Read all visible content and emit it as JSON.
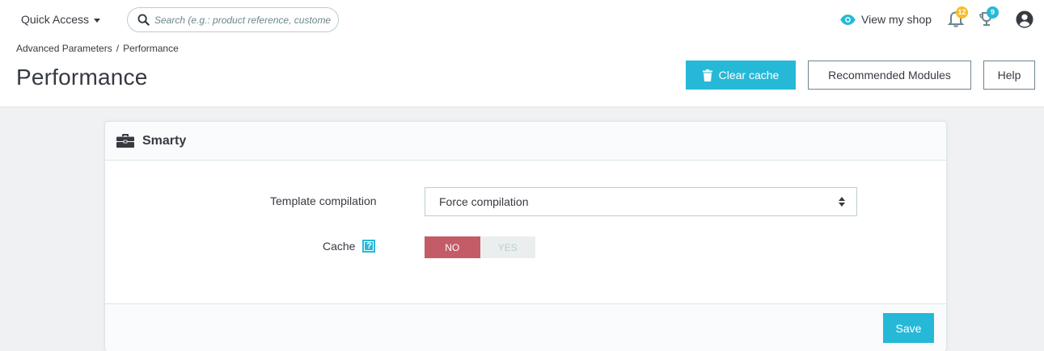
{
  "header": {
    "quick_access_label": "Quick Access",
    "search": {
      "placeholder": "Search (e.g.: product reference, custome",
      "value": ""
    },
    "view_shop_label": "View my shop",
    "notifications": [
      {
        "name": "orders",
        "icon": "bell-icon",
        "count": "12",
        "badge_color": "#fbbb22"
      },
      {
        "name": "customers",
        "icon": "trophy-icon",
        "count": "9",
        "badge_color": "#25b9d7"
      }
    ],
    "avatar_icon": "user-circle-icon"
  },
  "breadcrumb": [
    "Advanced Parameters",
    "/",
    "Performance"
  ],
  "page_title": "Performance",
  "toolbar": {
    "clear_cache_label": "Clear cache",
    "recommended_modules_label": "Recommended Modules",
    "help_label": "Help"
  },
  "panel": {
    "title": "Smarty",
    "icon": "briefcase-icon",
    "template_compilation": {
      "label": "Template compilation",
      "selected": "Force compilation"
    },
    "cache": {
      "label": "Cache",
      "help_glyph": "?",
      "no_label": "NO",
      "yes_label": "YES",
      "value": "NO"
    },
    "save_label": "Save"
  },
  "colors": {
    "accent": "#25b9d7",
    "toggle_off": "#c45c67",
    "text": "#363a41",
    "background": "#eff1f2"
  }
}
